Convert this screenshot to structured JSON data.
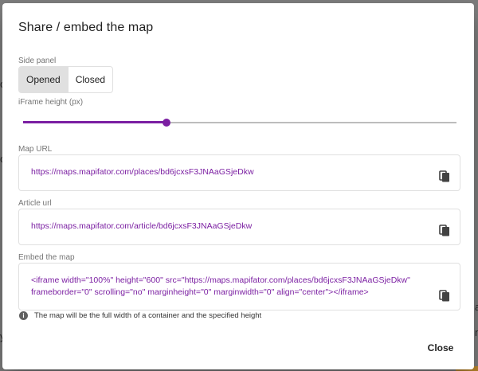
{
  "dialog": {
    "title": "Share / embed the map",
    "side_panel": {
      "label": "Side panel",
      "options": [
        "Opened",
        "Closed"
      ],
      "selected": "Opened"
    },
    "iframe_height": {
      "label": "iFrame height (px)",
      "value_fraction": 0.33
    },
    "map_url": {
      "label": "Map URL",
      "value": "https://maps.mapifator.com/places/bd6jcxsF3JNAaGSjeDkw"
    },
    "article_url": {
      "label": "Article url",
      "value": "https://maps.mapifator.com/article/bd6jcxsF3JNAaGSjeDkw"
    },
    "embed": {
      "label": "Embed the map",
      "value": "<iframe width=\"100%\" height=\"600\" src=\"https://maps.mapifator.com/places/bd6jcxsF3JNAaGSjeDkw\"\nframeborder=\"0\" scrolling=\"no\" marginheight=\"0\" marginwidth=\"0\" align=\"center\"></iframe>"
    },
    "info": {
      "icon": "info-icon",
      "text": "The map will be the full width of a container and the specified height"
    },
    "close_label": "Close",
    "accent_color": "#7b1fa2"
  }
}
